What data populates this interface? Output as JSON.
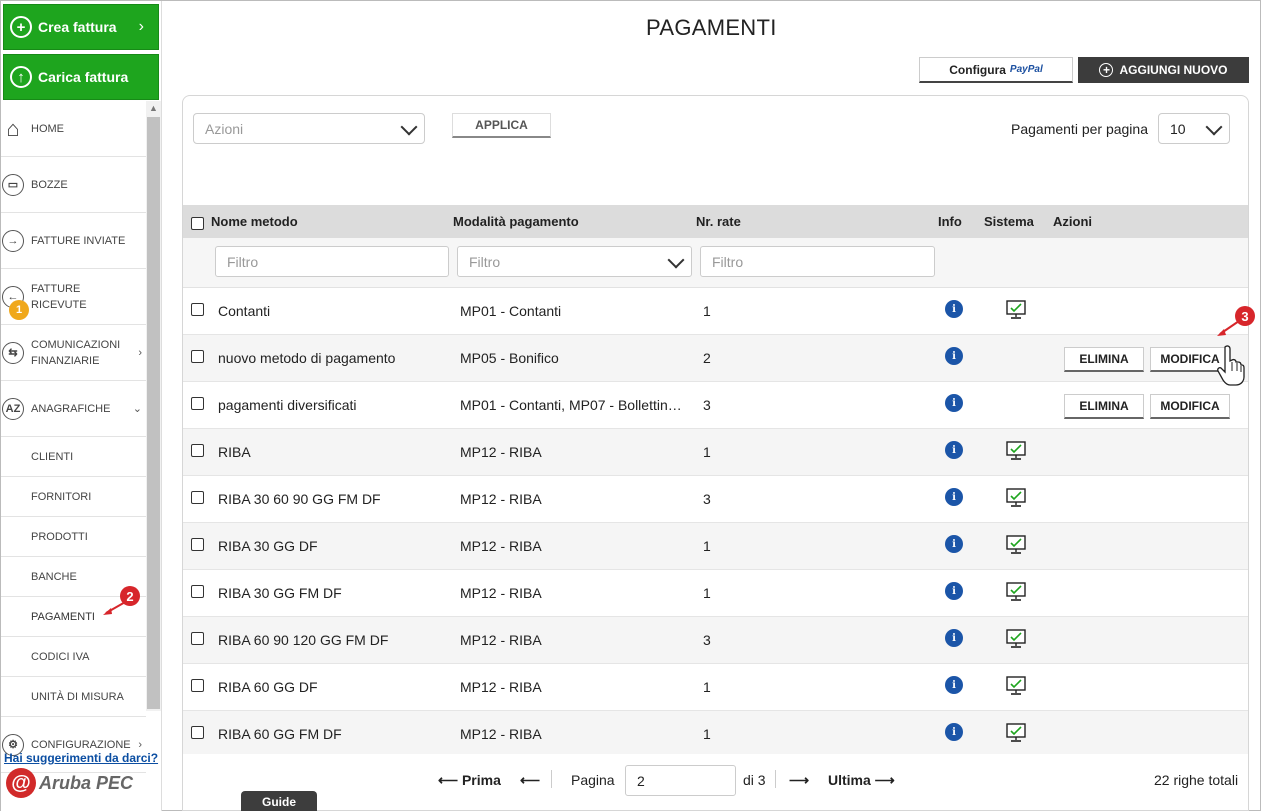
{
  "sidebar": {
    "crea_label": "Crea fattura",
    "carica_label": "Carica fattura",
    "items": [
      {
        "label": "HOME"
      },
      {
        "label": "BOZZE"
      },
      {
        "label": "FATTURE INVIATE"
      },
      {
        "label": "FATTURE RICEVUTE",
        "badge": "1"
      },
      {
        "label": "COMUNICAZIONI FINANZIARIE"
      },
      {
        "label": "ANAGRAFICHE"
      },
      {
        "label": "CLIENTI"
      },
      {
        "label": "FORNITORI"
      },
      {
        "label": "PRODOTTI"
      },
      {
        "label": "BANCHE"
      },
      {
        "label": "PAGAMENTI"
      },
      {
        "label": "CODICI IVA"
      },
      {
        "label": "UNITÀ DI MISURA"
      },
      {
        "label": "CONFIGURAZIONE"
      }
    ],
    "feedback_link": "Hai suggerimenti da darci?",
    "logo": "Aruba PEC",
    "guide_tab": "Guide"
  },
  "callouts": {
    "one": "2",
    "two": "3"
  },
  "header": {
    "title": "PAGAMENTI",
    "paypal_label": "Configura",
    "paypal_brand": "PayPal",
    "add_label": "AGGIUNGI NUOVO"
  },
  "toolbar": {
    "actions_placeholder": "Azioni",
    "apply_label": "APPLICA",
    "per_page_label": "Pagamenti per pagina",
    "per_page_value": "10"
  },
  "table": {
    "columns": {
      "nome": "Nome metodo",
      "modalita": "Modalità pagamento",
      "rate": "Nr. rate",
      "info": "Info",
      "sistema": "Sistema",
      "azioni": "Azioni"
    },
    "filter_placeholder": "Filtro",
    "delete_label": "ELIMINA",
    "edit_label": "MODIFICA",
    "rows": [
      {
        "nome": "Contanti",
        "modalita": "MP01 - Contanti",
        "rate": "1",
        "sistema": true,
        "actions": false
      },
      {
        "nome": "nuovo metodo di pagamento",
        "modalita": "MP05 - Bonifico",
        "rate": "2",
        "sistema": false,
        "actions": true
      },
      {
        "nome": "pagamenti diversificati",
        "modalita": "MP01 - Contanti, MP07 - Bollettin…",
        "rate": "3",
        "sistema": false,
        "actions": true
      },
      {
        "nome": "RIBA",
        "modalita": "MP12 - RIBA",
        "rate": "1",
        "sistema": true,
        "actions": false
      },
      {
        "nome": "RIBA 30 60 90 GG FM DF",
        "modalita": "MP12 - RIBA",
        "rate": "3",
        "sistema": true,
        "actions": false
      },
      {
        "nome": "RIBA 30 GG DF",
        "modalita": "MP12 - RIBA",
        "rate": "1",
        "sistema": true,
        "actions": false
      },
      {
        "nome": "RIBA 30 GG FM DF",
        "modalita": "MP12 - RIBA",
        "rate": "1",
        "sistema": true,
        "actions": false
      },
      {
        "nome": "RIBA 60 90 120 GG FM DF",
        "modalita": "MP12 - RIBA",
        "rate": "3",
        "sistema": true,
        "actions": false
      },
      {
        "nome": "RIBA 60 GG DF",
        "modalita": "MP12 - RIBA",
        "rate": "1",
        "sistema": true,
        "actions": false
      },
      {
        "nome": "RIBA 60 GG FM DF",
        "modalita": "MP12 - RIBA",
        "rate": "1",
        "sistema": true,
        "actions": false
      }
    ]
  },
  "pager": {
    "first_label": "Prima",
    "page_label": "Pagina",
    "page_value": "2",
    "of_label": "di 3",
    "last_label": "Ultima",
    "total_label": "22 righe totali"
  },
  "colors": {
    "green": "#1ea51e",
    "dark": "#3c3c3c",
    "info_blue": "#1b55a8",
    "callout_red": "#d7262b",
    "badge_orange": "#f0a81b"
  }
}
